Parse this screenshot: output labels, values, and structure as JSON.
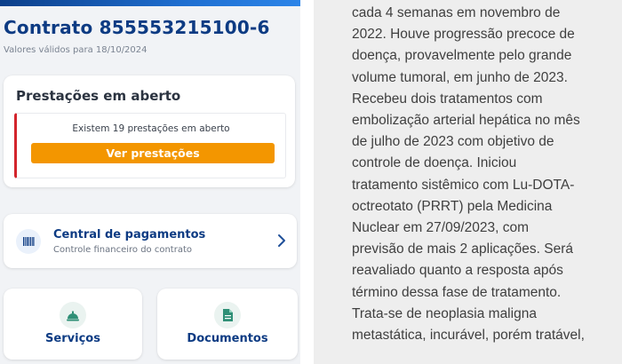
{
  "header": {
    "contract_title": "Contrato 855553215100-6",
    "valid_values_note": "Valores válidos para 18/10/2024"
  },
  "installments_card": {
    "title": "Prestações em aberto",
    "open_count_text": "Existem 19 prestações em aberto",
    "view_button_label": "Ver prestações"
  },
  "payments_central": {
    "title": "Central de pagamentos",
    "subtitle": "Controle financeiro do contrato",
    "icon": "barcode-icon"
  },
  "tiles": [
    {
      "label": "Serviços",
      "icon": "service-bell-icon"
    },
    {
      "label": "Documentos",
      "icon": "document-icon"
    }
  ],
  "document_lines": [
    "cada 4 semanas em novembro de",
    "2022. Houve progressão precoce de",
    "doença, provavelmente pelo grande",
    "volume tumoral, em junho de 2023.",
    "Recebeu dois tratamentos com",
    "embolização arterial hepática no mês",
    "de julho de 2023 com objetivo de",
    "controle de doença. Iniciou",
    "tratamento sistêmico com Lu-DOTA-",
    "octreotato (PRRT) pela Medicina",
    "Nuclear em 27/09/2023, com",
    "previsão de mais 2 aplicações. Será",
    "reavaliado quanto a resposta após",
    "término dessa fase de tratamento.",
    "Trata-se de neoplasia maligna",
    "metastática, incurável, porém tratável,"
  ],
  "colors": {
    "brand_blue": "#0d3b83",
    "accent_orange": "#f39600",
    "alert_red": "#d3242c",
    "tile_icon_green": "#2f8f76"
  }
}
